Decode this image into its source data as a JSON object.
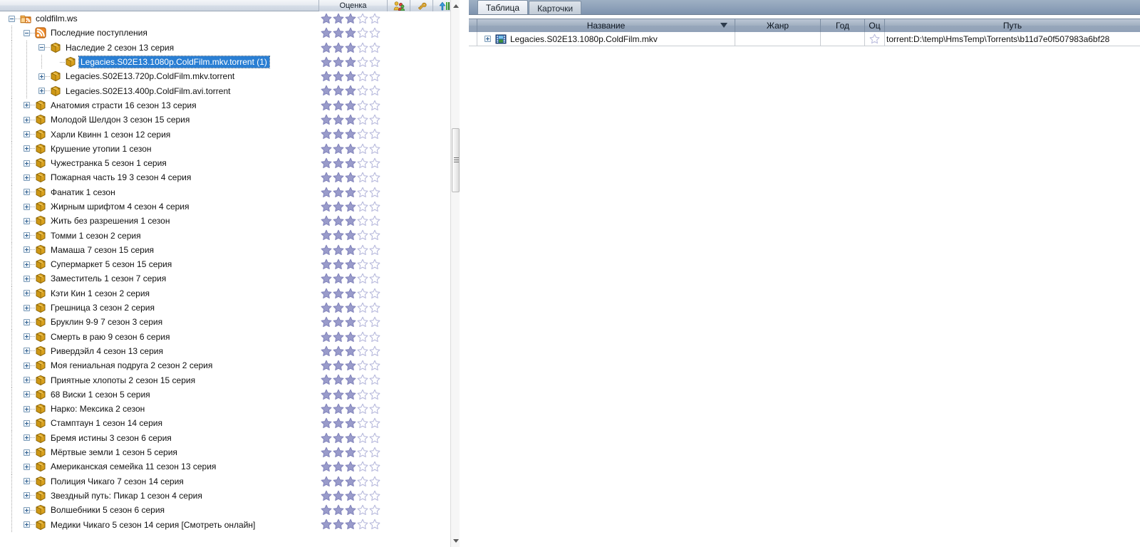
{
  "left_panel": {
    "header": {
      "rating_column_label": "Оценка",
      "icons": [
        "people-icon",
        "key-icon",
        "upload-arrow-icon"
      ]
    },
    "scrollbar": {
      "up_arrow": "scroll-up-arrow",
      "down_arrow": "scroll-down-arrow"
    },
    "tree": [
      {
        "label": "coldfilm.ws",
        "indent": 0,
        "toggle": "minus",
        "icon": "rss-folder-icon",
        "rating": 3,
        "selected": false
      },
      {
        "label": "Последние поступления",
        "indent": 1,
        "toggle": "minus",
        "icon": "rss-feed-icon",
        "rating": 3,
        "selected": false
      },
      {
        "label": "Наследие 2 сезон 13 серия",
        "indent": 2,
        "toggle": "minus",
        "icon": "package-icon",
        "rating": 3,
        "selected": false
      },
      {
        "label": "Legacies.S02E13.1080p.ColdFilm.mkv.torrent (1)",
        "indent": 3,
        "toggle": "none",
        "icon": "package-icon",
        "rating": 3,
        "selected": true
      },
      {
        "label": "Legacies.S02E13.720p.ColdFilm.mkv.torrent",
        "indent": 2,
        "toggle": "plus",
        "icon": "package-icon",
        "rating": 3,
        "selected": false
      },
      {
        "label": "Legacies.S02E13.400p.ColdFilm.avi.torrent",
        "indent": 2,
        "toggle": "plus",
        "icon": "package-icon",
        "rating": 3,
        "selected": false
      },
      {
        "label": "Анатомия страсти 16 сезон 13 серия",
        "indent": 1,
        "toggle": "plus",
        "icon": "package-icon",
        "rating": 3,
        "selected": false
      },
      {
        "label": "Молодой Шелдон 3 сезон 15 серия",
        "indent": 1,
        "toggle": "plus",
        "icon": "package-icon",
        "rating": 3,
        "selected": false
      },
      {
        "label": "Харли Квинн 1 сезон 12 серия",
        "indent": 1,
        "toggle": "plus",
        "icon": "package-icon",
        "rating": 3,
        "selected": false
      },
      {
        "label": "Крушение утопии 1 сезон",
        "indent": 1,
        "toggle": "plus",
        "icon": "package-icon",
        "rating": 3,
        "selected": false
      },
      {
        "label": "Чужестранка 5 сезон 1 серия",
        "indent": 1,
        "toggle": "plus",
        "icon": "package-icon",
        "rating": 3,
        "selected": false
      },
      {
        "label": "Пожарная часть 19 3 сезон 4 серия",
        "indent": 1,
        "toggle": "plus",
        "icon": "package-icon",
        "rating": 3,
        "selected": false
      },
      {
        "label": "Фанатик 1 сезон",
        "indent": 1,
        "toggle": "plus",
        "icon": "package-icon",
        "rating": 3,
        "selected": false
      },
      {
        "label": "Жирным шрифтом 4 сезон 4 серия",
        "indent": 1,
        "toggle": "plus",
        "icon": "package-icon",
        "rating": 3,
        "selected": false
      },
      {
        "label": "Жить без разрешения 1 сезон",
        "indent": 1,
        "toggle": "plus",
        "icon": "package-icon",
        "rating": 3,
        "selected": false
      },
      {
        "label": "Томми 1 сезон 2 серия",
        "indent": 1,
        "toggle": "plus",
        "icon": "package-icon",
        "rating": 3,
        "selected": false
      },
      {
        "label": "Мамаша 7 сезон 15 серия",
        "indent": 1,
        "toggle": "plus",
        "icon": "package-icon",
        "rating": 3,
        "selected": false
      },
      {
        "label": "Супермаркет 5 сезон 15 серия",
        "indent": 1,
        "toggle": "plus",
        "icon": "package-icon",
        "rating": 3,
        "selected": false
      },
      {
        "label": "Заместитель 1 сезон 7 серия",
        "indent": 1,
        "toggle": "plus",
        "icon": "package-icon",
        "rating": 3,
        "selected": false
      },
      {
        "label": "Кэти Кин 1 сезон 2 серия",
        "indent": 1,
        "toggle": "plus",
        "icon": "package-icon",
        "rating": 3,
        "selected": false
      },
      {
        "label": "Грешница 3 сезон 2 серия",
        "indent": 1,
        "toggle": "plus",
        "icon": "package-icon",
        "rating": 3,
        "selected": false
      },
      {
        "label": "Бруклин 9-9 7 сезон 3 серия",
        "indent": 1,
        "toggle": "plus",
        "icon": "package-icon",
        "rating": 3,
        "selected": false
      },
      {
        "label": "Смерть в раю 9 сезон 6 серия",
        "indent": 1,
        "toggle": "plus",
        "icon": "package-icon",
        "rating": 3,
        "selected": false
      },
      {
        "label": "Ривердэйл 4 сезон 13 серия",
        "indent": 1,
        "toggle": "plus",
        "icon": "package-icon",
        "rating": 3,
        "selected": false
      },
      {
        "label": "Моя гениальная подруга 2 сезон 2 серия",
        "indent": 1,
        "toggle": "plus",
        "icon": "package-icon",
        "rating": 3,
        "selected": false
      },
      {
        "label": "Приятные хлопоты 2 сезон 15 серия",
        "indent": 1,
        "toggle": "plus",
        "icon": "package-icon",
        "rating": 3,
        "selected": false
      },
      {
        "label": "68 Виски 1 сезон 5 серия",
        "indent": 1,
        "toggle": "plus",
        "icon": "package-icon",
        "rating": 3,
        "selected": false
      },
      {
        "label": "Нарко: Мексика 2 сезон",
        "indent": 1,
        "toggle": "plus",
        "icon": "package-icon",
        "rating": 3,
        "selected": false
      },
      {
        "label": "Стамптаун 1 сезон 14 серия",
        "indent": 1,
        "toggle": "plus",
        "icon": "package-icon",
        "rating": 3,
        "selected": false
      },
      {
        "label": "Бремя истины 3 сезон 6 серия",
        "indent": 1,
        "toggle": "plus",
        "icon": "package-icon",
        "rating": 3,
        "selected": false
      },
      {
        "label": "Мёртвые земли 1 сезон 5 серия",
        "indent": 1,
        "toggle": "plus",
        "icon": "package-icon",
        "rating": 3,
        "selected": false
      },
      {
        "label": "Американская семейка 11 сезон 13 серия",
        "indent": 1,
        "toggle": "plus",
        "icon": "package-icon",
        "rating": 3,
        "selected": false
      },
      {
        "label": "Полиция Чикаго 7 сезон 14 серия",
        "indent": 1,
        "toggle": "plus",
        "icon": "package-icon",
        "rating": 3,
        "selected": false
      },
      {
        "label": "Звездный путь: Пикар 1 сезон 4 серия",
        "indent": 1,
        "toggle": "plus",
        "icon": "package-icon",
        "rating": 3,
        "selected": false
      },
      {
        "label": "Волшебники 5 сезон 6 серия",
        "indent": 1,
        "toggle": "plus",
        "icon": "package-icon",
        "rating": 3,
        "selected": false
      },
      {
        "label": "Медики Чикаго 5 сезон 14 серия [Смотреть онлайн]",
        "indent": 1,
        "toggle": "plus",
        "icon": "package-icon",
        "rating": 3,
        "selected": false
      }
    ]
  },
  "right_panel": {
    "tabs": [
      {
        "label": "Таблица",
        "active": true
      },
      {
        "label": "Карточки",
        "active": false
      }
    ],
    "grid": {
      "columns": [
        {
          "key": "name",
          "label": "Название",
          "sorted": true
        },
        {
          "key": "genre",
          "label": "Жанр",
          "sorted": false
        },
        {
          "key": "year",
          "label": "Год",
          "sorted": false
        },
        {
          "key": "rate",
          "label": "Оц",
          "sorted": false
        },
        {
          "key": "path",
          "label": "Путь",
          "sorted": false
        }
      ],
      "rows": [
        {
          "name": "Legacies.S02E13.1080p.ColdFilm.mkv",
          "icon": "film-strip-icon",
          "genre": "",
          "year": "",
          "rating": 1,
          "path": "torrent:D:\\temp\\HmsTemp\\Torrents\\b11d7e0f507983a6bf28"
        }
      ]
    }
  },
  "colors": {
    "selection": "#2a7fd4",
    "header_blue": "#9dacbf",
    "tab_strip": "#8fa2ba",
    "star_filled": "#9a9ccb",
    "star_empty": "#c9cbe6",
    "package_gold": "#d4a017",
    "rss_orange": "#f08b28"
  }
}
